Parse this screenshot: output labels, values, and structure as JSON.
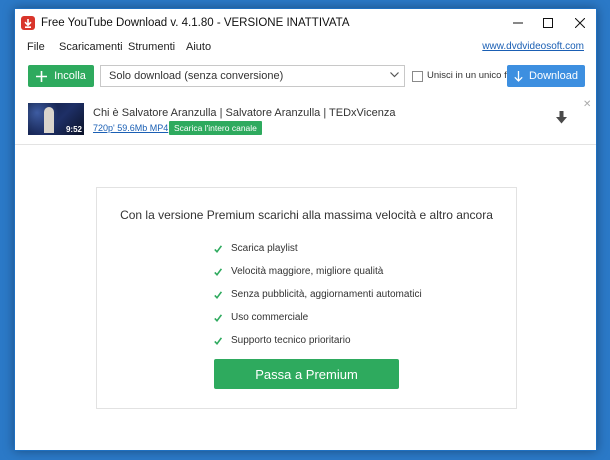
{
  "window": {
    "title": "Free YouTube Download v. 4.1.80 - VERSIONE INATTIVATA",
    "accent_color": "#2eaa5e",
    "download_color": "#3d8fe0"
  },
  "menu": {
    "items": [
      "File",
      "Scaricamenti",
      "Strumenti",
      "Aiuto"
    ],
    "site_link": "www.dvdvideosoft.com"
  },
  "toolbar": {
    "paste_label": "Incolla",
    "format_value": "Solo download (senza conversione)",
    "join_label": "Unisci in un unico file",
    "join_checked": false,
    "download_label": "Download"
  },
  "video": {
    "duration": "9:52",
    "title": "Chi è Salvatore Aranzulla | Salvatore Aranzulla | TEDxVicenza",
    "format": "720p' 59.6Mb MP4",
    "channel_button": "Scarica l'intero canale"
  },
  "promo": {
    "headline": "Con la versione Premium scarichi alla massima velocità e altro ancora",
    "features": [
      "Scarica playlist",
      "Velocità maggiore, migliore qualità",
      "Senza pubblicità, aggiornamenti automatici",
      "Uso commerciale",
      "Supporto tecnico prioritario"
    ],
    "button_label": "Passa a Premium"
  }
}
